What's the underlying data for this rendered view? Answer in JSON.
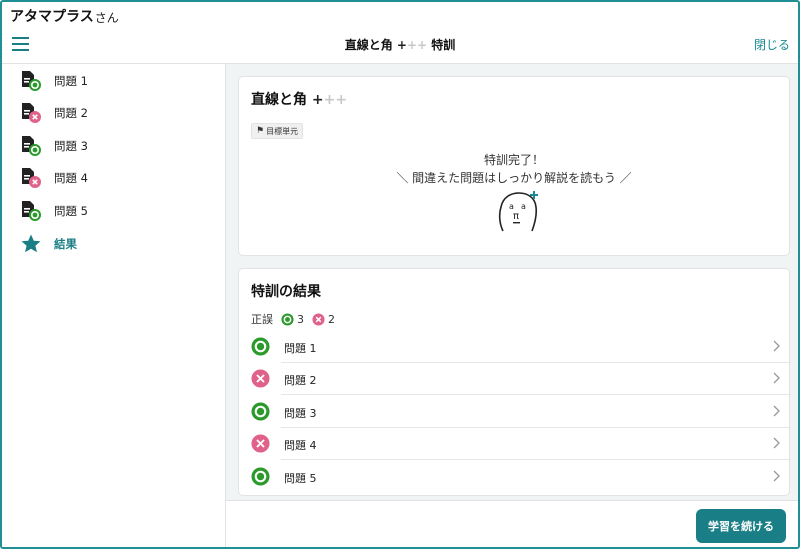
{
  "app": {
    "username": "アタマプラス",
    "honorific": "さん"
  },
  "header": {
    "title_main": "直線と角",
    "title_plus": "+",
    "title_plus_faded": "++",
    "title_suffix": "特訓",
    "close_label": "閉じる"
  },
  "sidebar": {
    "items": [
      {
        "label": "問題 1",
        "status": "correct"
      },
      {
        "label": "問題 2",
        "status": "wrong"
      },
      {
        "label": "問題 3",
        "status": "correct"
      },
      {
        "label": "問題 4",
        "status": "wrong"
      },
      {
        "label": "問題 5",
        "status": "correct"
      },
      {
        "label": "結果",
        "status": "result"
      }
    ]
  },
  "summary_card": {
    "title_main": "直線と角",
    "title_plus": "+",
    "title_plus_faded": "++",
    "tag_label": "目標単元",
    "complete_line1": "特訓完了！",
    "complete_line2": "＼ 間違えた問題はしっかり解説を読もう ／",
    "mascot_icon": "pi-mascot-icon"
  },
  "results_card": {
    "title": "特訓の結果",
    "tally_label": "正誤",
    "correct_count": "3",
    "wrong_count": "2",
    "rows": [
      {
        "label": "問題 1",
        "status": "correct"
      },
      {
        "label": "問題 2",
        "status": "wrong"
      },
      {
        "label": "問題 3",
        "status": "correct"
      },
      {
        "label": "問題 4",
        "status": "wrong"
      },
      {
        "label": "問題 5",
        "status": "correct"
      }
    ]
  },
  "footer": {
    "continue_label": "学習を続ける"
  },
  "colors": {
    "accent": "#1a7e86",
    "correct": "#2b9a2b",
    "wrong": "#e0628a"
  }
}
